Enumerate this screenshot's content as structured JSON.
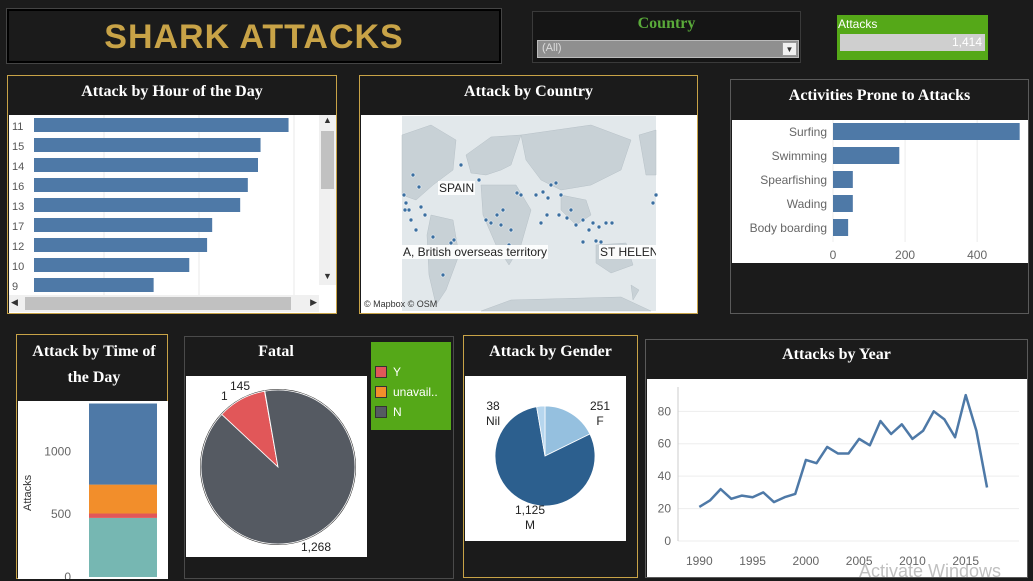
{
  "header": {
    "title": "SHARK ATTACKS"
  },
  "filter": {
    "label": "Country",
    "value": "(All)"
  },
  "kpi": {
    "label": "Attacks",
    "value": "1,414"
  },
  "hour_chart": {
    "title": "Attack by Hour of the Day",
    "chart_data": {
      "type": "bar",
      "categories": [
        "11",
        "15",
        "14",
        "16",
        "13",
        "17",
        "12",
        "10",
        "9"
      ],
      "values": [
        100,
        89,
        88,
        84,
        81,
        70,
        68,
        61,
        47
      ],
      "xlim": [
        0,
        110
      ]
    }
  },
  "map": {
    "title": "Attack by Country",
    "labels": [
      "SPAIN",
      "A, British overseas territory",
      "ST HELENA"
    ],
    "attribution": "© Mapbox © OSM"
  },
  "activities": {
    "title": "Activities Prone to Attacks",
    "chart_data": {
      "type": "bar",
      "categories": [
        "Surfing",
        "Swimming",
        "Spearfishing",
        "Wading",
        "Body boarding"
      ],
      "values": [
        518,
        184,
        55,
        55,
        42
      ],
      "xticks": [
        "0",
        "200",
        "400"
      ],
      "xlim": [
        0,
        530
      ]
    }
  },
  "time_of_day": {
    "title": "Attack by Time of the Day",
    "chart_data": {
      "type": "bar",
      "stacked": true,
      "ylabel": "Attacks",
      "yticks": [
        "0",
        "500",
        "1000"
      ],
      "ylim": [
        0,
        1400
      ],
      "series": [
        {
          "values": [
            470
          ],
          "color": "#76b7b2"
        },
        {
          "values": [
            35
          ],
          "color": "#e15759"
        },
        {
          "values": [
            230
          ],
          "color": "#f28e2b"
        },
        {
          "values": [
            645
          ],
          "color": "#4e79a7"
        }
      ]
    }
  },
  "fatal": {
    "title": "Fatal",
    "legend": [
      {
        "label": "Y",
        "color": "#e15759"
      },
      {
        "label": "unavail..",
        "color": "#f28e2b"
      },
      {
        "label": "N",
        "color": "#555a62"
      }
    ],
    "chart_data": {
      "type": "pie",
      "labels": [
        "Y",
        "unavailable",
        "N"
      ],
      "values": [
        145,
        1,
        1268
      ],
      "data_labels": [
        "145",
        "1",
        "1,268"
      ]
    }
  },
  "gender": {
    "title": "Attack by Gender",
    "chart_data": {
      "type": "pie",
      "labels": [
        "F",
        "M",
        "Nil"
      ],
      "values": [
        251,
        1125,
        38
      ],
      "data_labels": [
        "251",
        "1,125",
        "38"
      ],
      "colors": [
        "#95c0df",
        "#2c5f8e",
        "#b6d6ee"
      ]
    }
  },
  "year": {
    "title": "Attacks by Year",
    "watermark": "Activate Windows",
    "chart_data": {
      "type": "line",
      "x": [
        1990,
        1991,
        1992,
        1993,
        1994,
        1995,
        1996,
        1997,
        1998,
        1999,
        2000,
        2001,
        2002,
        2003,
        2004,
        2005,
        2006,
        2007,
        2008,
        2009,
        2010,
        2011,
        2012,
        2013,
        2014,
        2015,
        2016,
        2017
      ],
      "y": [
        21,
        25,
        32,
        26,
        28,
        27,
        30,
        24,
        27,
        29,
        50,
        48,
        58,
        54,
        54,
        63,
        59,
        74,
        66,
        72,
        63,
        68,
        80,
        75,
        64,
        90,
        68,
        33
      ],
      "xticks": [
        "1990",
        "1995",
        "2000",
        "2005",
        "2010",
        "2015"
      ],
      "yticks": [
        "0",
        "20",
        "40",
        "60",
        "80"
      ],
      "xlim": [
        1988,
        2020
      ],
      "ylim": [
        0,
        95
      ]
    }
  }
}
